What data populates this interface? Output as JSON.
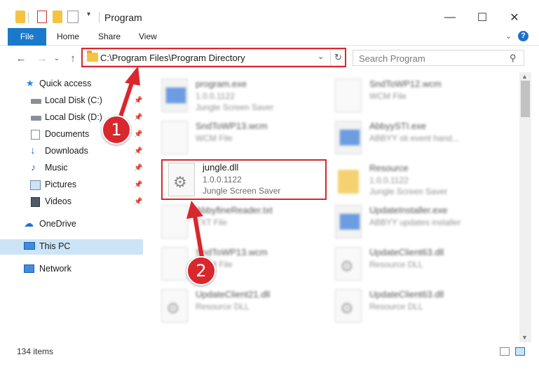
{
  "window": {
    "title": "Program"
  },
  "ribbon": {
    "tabs": [
      "File",
      "Home",
      "Share",
      "View"
    ]
  },
  "address": {
    "path": "C:\\Program Files\\Program Directory"
  },
  "search": {
    "placeholder": "Search Program"
  },
  "navigation": {
    "items": [
      {
        "label": "Quick access",
        "pinned": false
      },
      {
        "label": "Local Disk (C:)",
        "pinned": true
      },
      {
        "label": "Local Disk (D:)",
        "pinned": true
      },
      {
        "label": "Documents",
        "pinned": true
      },
      {
        "label": "Downloads",
        "pinned": true
      },
      {
        "label": "Music",
        "pinned": true
      },
      {
        "label": "Pictures",
        "pinned": true
      },
      {
        "label": "Videos",
        "pinned": true
      },
      {
        "label": "OneDrive",
        "pinned": false
      },
      {
        "label": "This PC",
        "pinned": false,
        "selected": true
      },
      {
        "label": "Network",
        "pinned": false
      }
    ]
  },
  "files": [
    {
      "name": "program.exe",
      "version": "1.0.0.1122",
      "desc": "Jungle Screen Saver",
      "icon": "app-setup-icon"
    },
    {
      "name": "SndToWP12.wcm",
      "version": "WCM File",
      "desc": "",
      "icon": "document-icon"
    },
    {
      "name": "SndToWP13.wcm",
      "version": "WCM File",
      "desc": "",
      "icon": "document-icon"
    },
    {
      "name": "AbbyySTI.exe",
      "version": "ABBYY sti event hand...",
      "desc": "",
      "icon": "app-window-icon"
    },
    {
      "name": "jungle.dll",
      "version": "1.0.0.1122",
      "desc": "Jungle Screen Saver",
      "icon": "dll-gear-icon"
    },
    {
      "name": "Resource",
      "version": "1.0.0.1122",
      "desc": "Jungle Screen Saver",
      "icon": "folder-icon"
    },
    {
      "name": "AbbyfineReader.txt",
      "version": "TXT File",
      "desc": "",
      "icon": "document-icon"
    },
    {
      "name": "UpdateInstaller.exe",
      "version": "ABBYY updates installer",
      "desc": "",
      "icon": "app-window-icon"
    },
    {
      "name": "SndToWP13.wcm",
      "version": "WCM File",
      "desc": "",
      "icon": "document-icon"
    },
    {
      "name": "UpdateClient63.dll",
      "version": "Resource DLL",
      "desc": "",
      "icon": "dll-gear-icon"
    },
    {
      "name": "UpdateClient21.dll",
      "version": "Resource DLL",
      "desc": "",
      "icon": "dll-gear-icon"
    },
    {
      "name": "UpdateClient63.dll",
      "version": "Resource DLL",
      "desc": "",
      "icon": "dll-gear-icon"
    }
  ],
  "status": {
    "item_count": "134 items"
  },
  "annotations": {
    "step1": "1",
    "step2": "2",
    "color": "#d9272e"
  }
}
